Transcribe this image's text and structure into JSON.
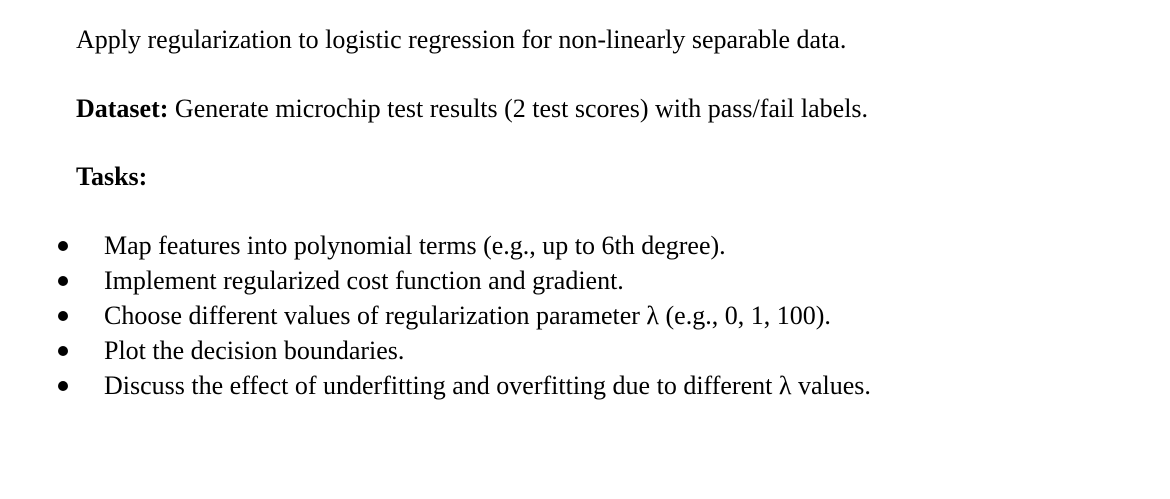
{
  "document": {
    "intro": "Apply regularization to logistic regression for non-linearly separable data.",
    "dataset": {
      "label": "Dataset:",
      "text": " Generate microchip test results (2 test scores) with pass/fail labels."
    },
    "tasks_heading": "Tasks:",
    "tasks": [
      "Map features into polynomial terms (e.g., up to 6th degree).",
      "Implement regularized cost function and gradient.",
      "Choose different values of regularization parameter λ (e.g., 0, 1, 100).",
      "Plot the decision boundaries.",
      "Discuss the effect of underfitting and overfitting due to different λ values."
    ]
  }
}
